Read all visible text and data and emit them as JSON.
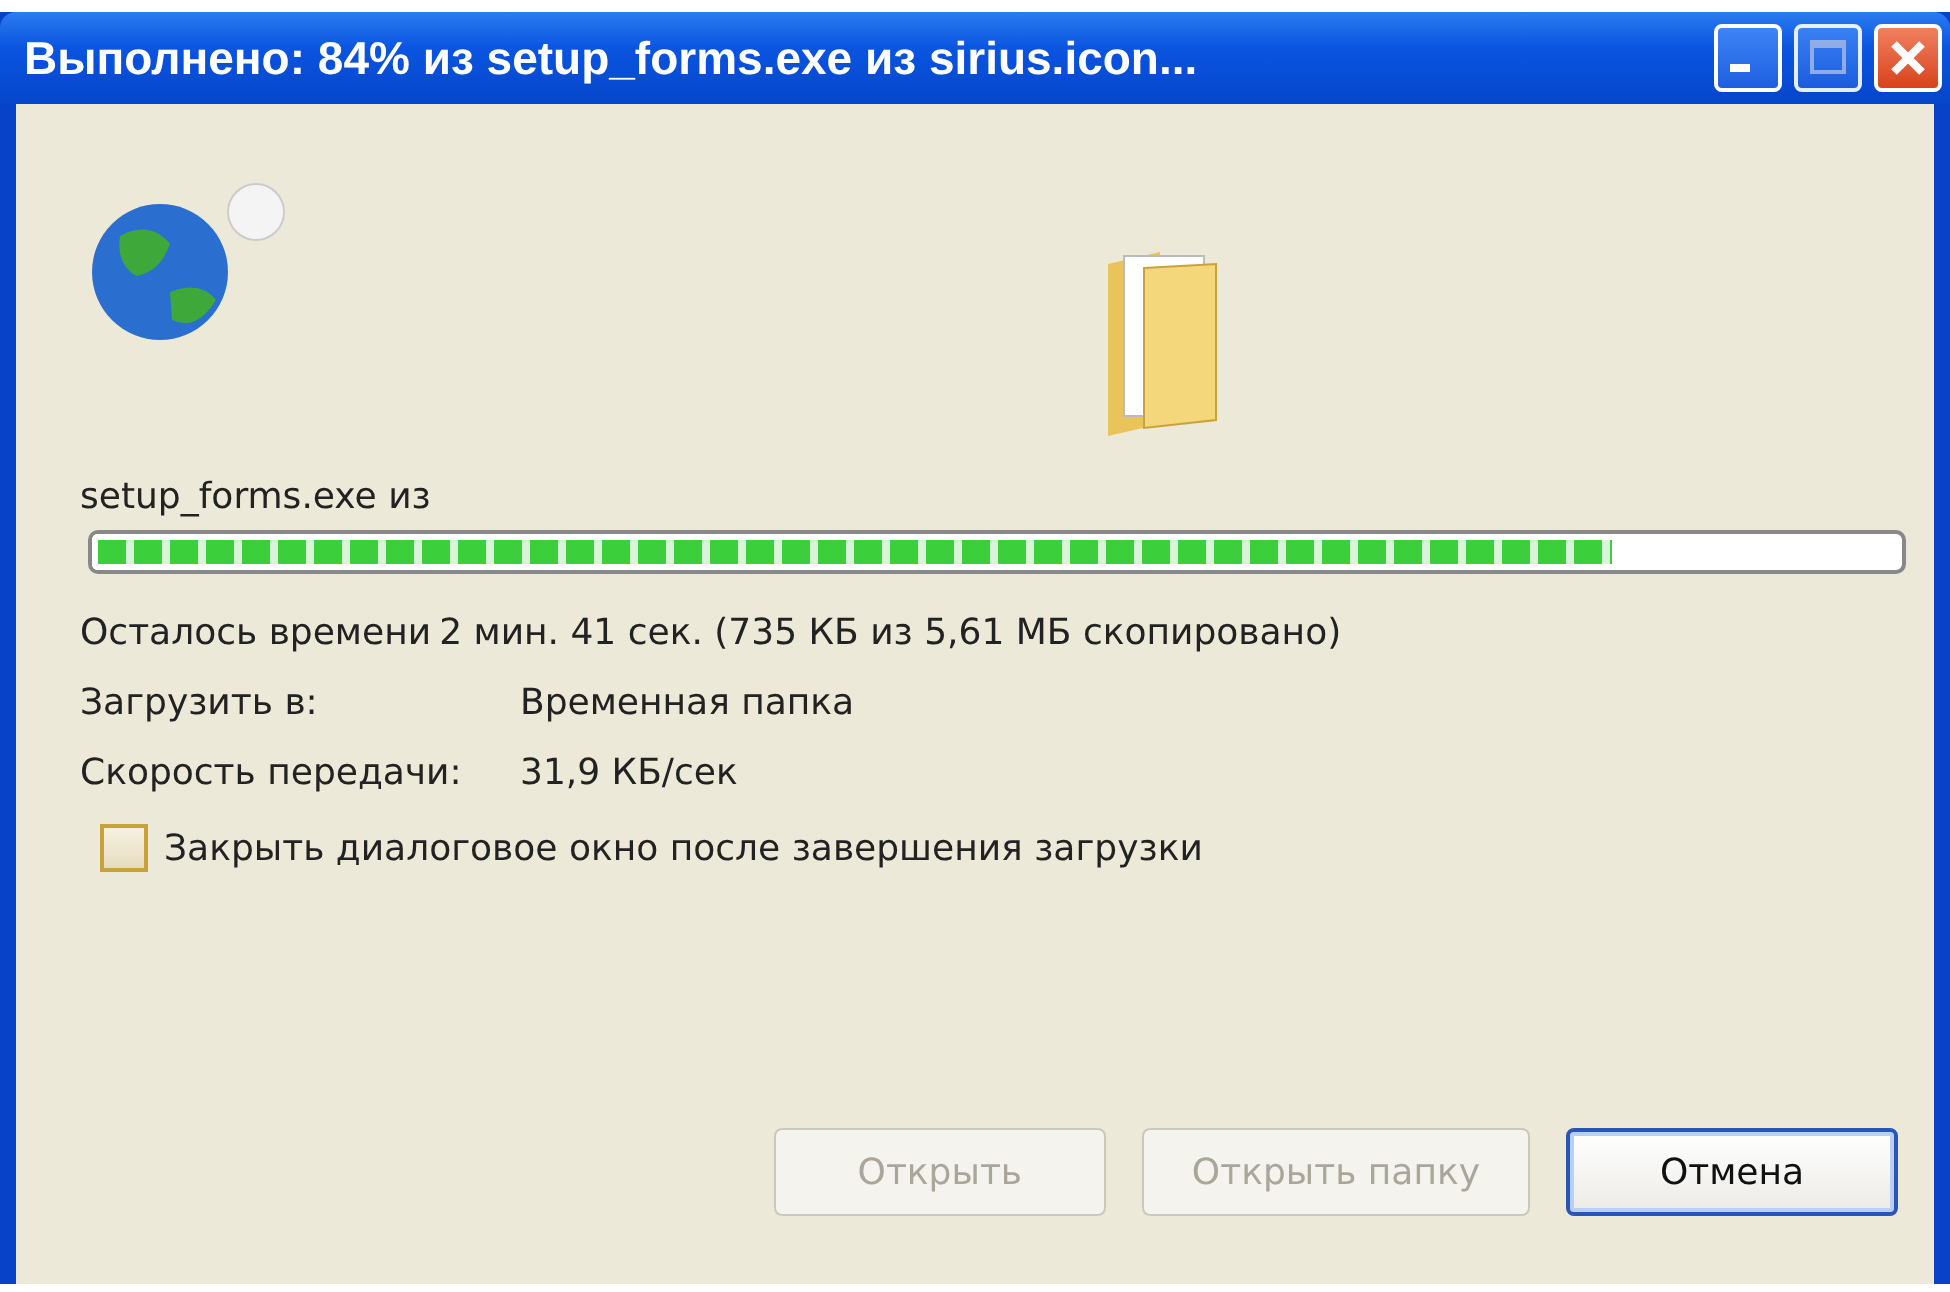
{
  "window": {
    "title": "Выполнено: 84% из setup_forms.exe из sirius.icon..."
  },
  "source": "setup_forms.exe из",
  "progress": {
    "level": 0.84
  },
  "details": [
    {
      "label": "Осталось времени",
      "value": "2 мин. 41 сек. (735 КБ из 5,61 МБ скопировано)",
      "kind": "tight"
    },
    {
      "label": "Загрузить в:",
      "value": "Временная папка",
      "kind": "column"
    },
    {
      "label": "Скорость передачи:",
      "value": "31,9 КБ/сек",
      "kind": "column"
    }
  ],
  "close_when_done": {
    "label": "Закрыть диалоговое окно после завершения загрузки",
    "checked": false
  },
  "buttons": [
    {
      "label": "Открыть",
      "disabled": true,
      "default": false
    },
    {
      "label": "Открыть папку",
      "disabled": true,
      "default": false
    },
    {
      "label": "Отмена",
      "disabled": false,
      "default": true
    }
  ]
}
